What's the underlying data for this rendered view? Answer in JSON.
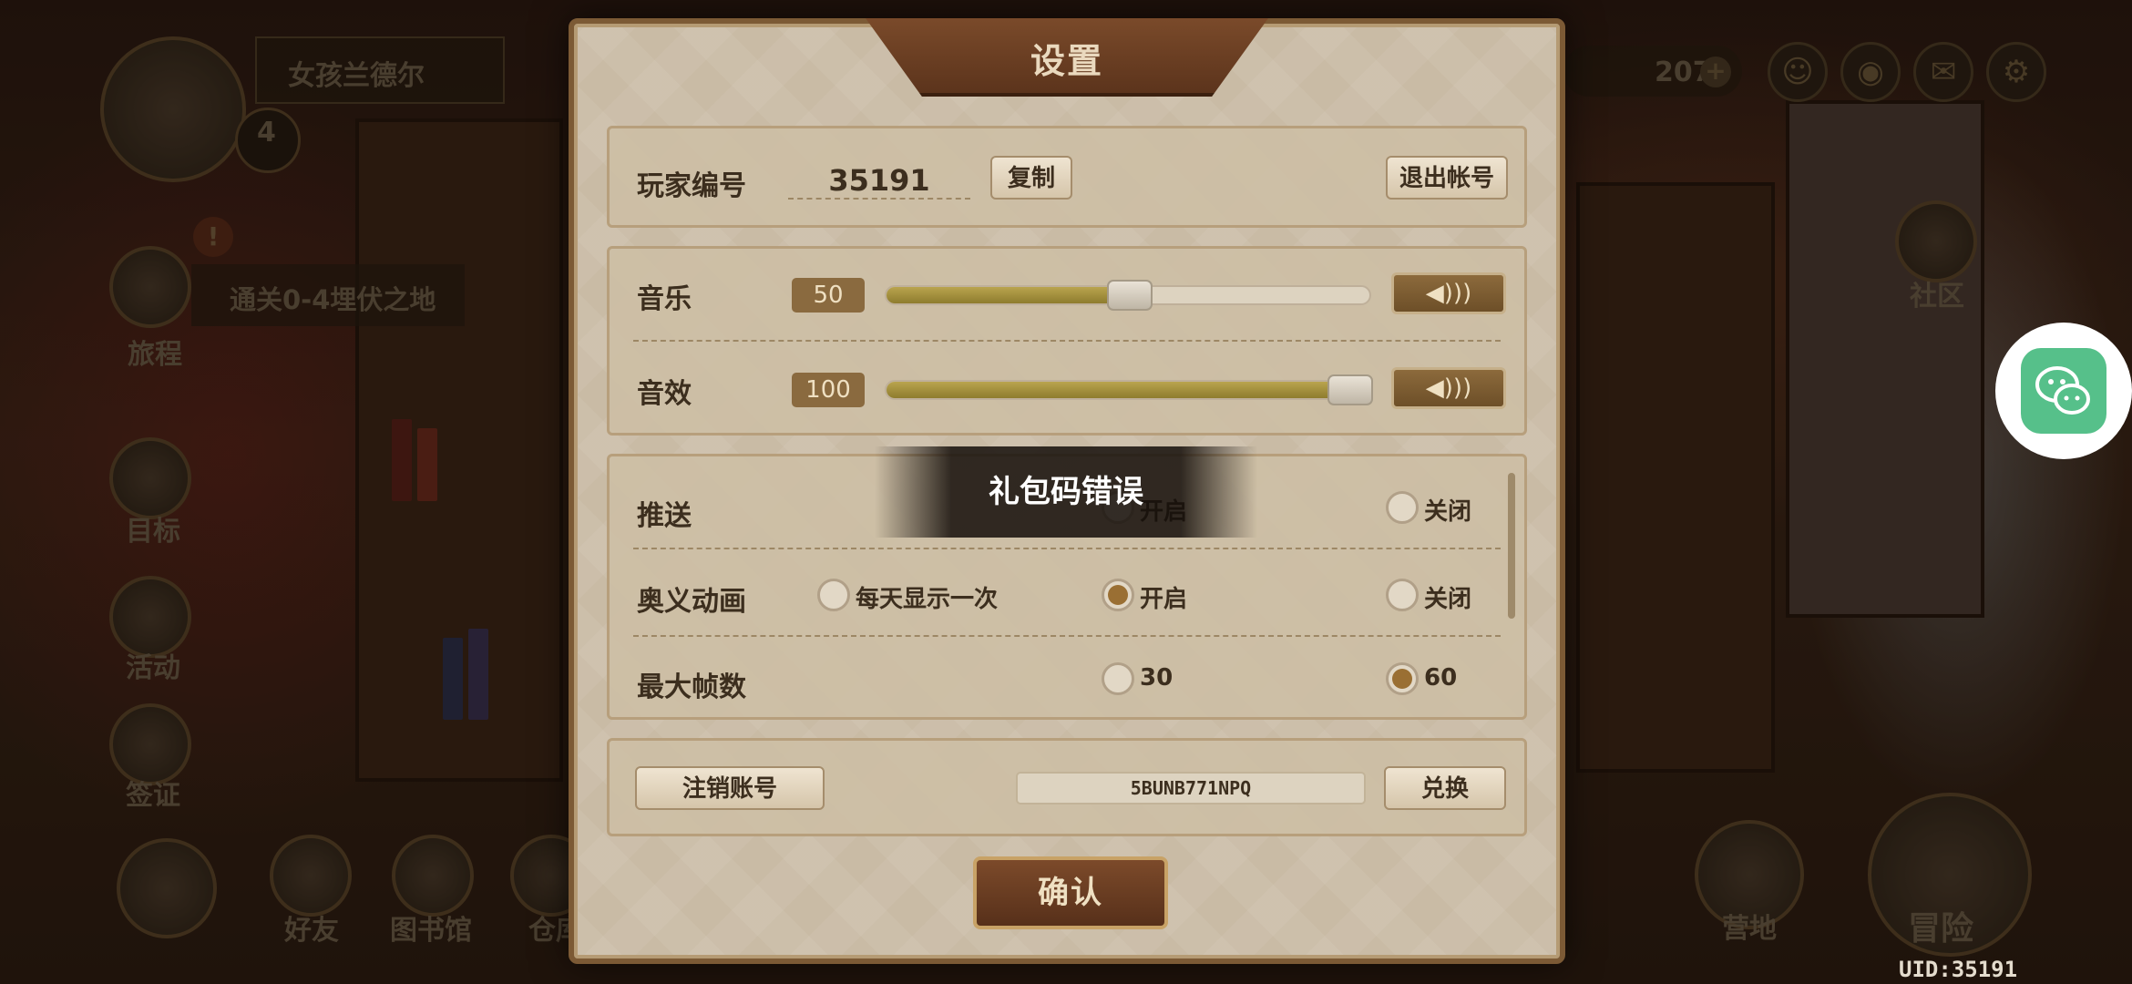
{
  "hud": {
    "player_name": "女孩兰德尔",
    "player_level": "4",
    "currency": "207",
    "quest": "通关0-4埋伏之地",
    "left_menu": [
      "旅程",
      "目标",
      "活动",
      "签证"
    ],
    "bottom_menu": [
      "好友",
      "图书馆",
      "仓库"
    ],
    "community": "社区",
    "camp": "营地",
    "adventure": "冒险",
    "uid": "UID:35191"
  },
  "settings": {
    "title": "设置",
    "player_id_label": "玩家编号",
    "player_id": "35191",
    "copy_label": "复制",
    "logout_label": "退出帐号",
    "music_label": "音乐",
    "music_value": "50",
    "music_level": 0.5,
    "sfx_label": "音效",
    "sfx_value": "100",
    "sfx_level": 1.0,
    "push_label": "推送",
    "push_options": [
      "开启",
      "关闭"
    ],
    "ultimate_label": "奥义动画",
    "ultimate_options": [
      "每天显示一次",
      "开启",
      "关闭"
    ],
    "ultimate_selected": "开启",
    "fps_label": "最大帧数",
    "fps_options": [
      "30",
      "60"
    ],
    "fps_selected": "60",
    "cancel_account_label": "注销账号",
    "gift_code": "5BUNB771NPQ",
    "redeem_label": "兑换",
    "confirm_label": "确认"
  },
  "toast": "礼包码错误",
  "colors": {
    "panel": "#c9bba5",
    "accent": "#7a4a2a",
    "chat": "#56c08a"
  },
  "icons": [
    "volume-icon",
    "wechat-icon",
    "mail-icon",
    "gear-icon",
    "plus-icon"
  ]
}
